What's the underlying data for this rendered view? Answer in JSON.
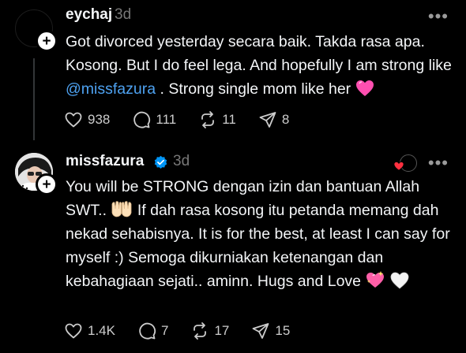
{
  "posts": [
    {
      "username": "eychaj",
      "time": "3d",
      "text_before_mention": "Got divorced yesterday secara baik. Takda rasa apa. Kosong. But I do feel lega. And hopefully I am strong like ",
      "mention": "@missfazura",
      "text_after_mention": " . Strong single mom like her ",
      "emoji": "pink-heart",
      "stats": {
        "likes": "938",
        "replies": "111",
        "reposts": "11",
        "shares": "8"
      }
    },
    {
      "username": "missfazura",
      "verified": true,
      "time": "3d",
      "text_part1": "You will be STRONG dengan izin dan bantuan Allah SWT.. ",
      "inline_emoji_1": "palms-up-together",
      "text_part2": " If dah rasa kosong itu petanda memang dah nekad sehabisnya. It is for the best, at least I can say for myself :) Semoga dikurniakan ketenangan dan kebahagiaan sejati.. aminn. Hugs and Love ",
      "inline_emoji_2": "sparkling-heart",
      "inline_emoji_3": "white-heart",
      "stats": {
        "likes": "1.4K",
        "replies": "7",
        "reposts": "17",
        "shares": "15"
      }
    }
  ],
  "icons": {
    "like": "heart-icon",
    "reply": "comment-icon",
    "repost": "repost-icon",
    "share": "send-icon",
    "more": "more-icon",
    "follow": "plus-icon",
    "verified": "verified-badge-icon"
  },
  "colors": {
    "background": "#000000",
    "text": "#f3f5f7",
    "muted": "#777777",
    "mention": "#4ea2f1",
    "verified": "#0095f6",
    "liked_heart": "#ff3040"
  }
}
